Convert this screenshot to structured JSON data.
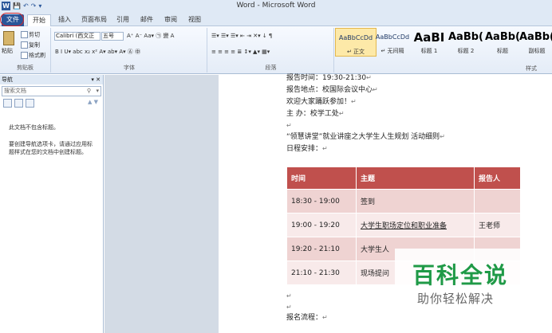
{
  "app": {
    "title": "Word - Microsoft Word",
    "quick_access": [
      "W",
      "💾",
      "↶",
      "↷",
      "▾"
    ]
  },
  "tabs": [
    {
      "label": "文件"
    },
    {
      "label": "开始"
    },
    {
      "label": "插入"
    },
    {
      "label": "页面布局"
    },
    {
      "label": "引用"
    },
    {
      "label": "邮件"
    },
    {
      "label": "审阅"
    },
    {
      "label": "视图"
    }
  ],
  "ribbon": {
    "clipboard": {
      "paste": "粘贴",
      "cut": "剪切",
      "copy": "复制",
      "format_painter": "格式刷",
      "label": "剪贴板"
    },
    "font": {
      "family": "Calibri (西文正",
      "size": "五号",
      "label": "字体",
      "row1": "A⁺ A⁻  Aa▾  ㉠ 變  A",
      "row2": "B  I  U▾  abc  x₂  x²   A▾  ab▾  A▾  Ⓐ  ㊥"
    },
    "paragraph": {
      "label": "段落",
      "row1": "☰▾  ☰▾  ☰▾   ⇤  ⇥   ✕▾  ↓  ¶",
      "row2": "≡  ≡  ≡  ≡  ≣   ↕▾   ▲▾  ▦▾"
    },
    "styles": {
      "label": "样式",
      "items": [
        {
          "sample": "AaBbCcDd",
          "name": "↵ 正文"
        },
        {
          "sample": "AaBbCcDd",
          "name": "↵ 无间隔"
        },
        {
          "sample": "AaBI",
          "name": "标题 1"
        },
        {
          "sample": "AaBb(",
          "name": "标题 2"
        },
        {
          "sample": "AaBb(",
          "name": "标题"
        },
        {
          "sample": "AaBb(",
          "name": "副标题"
        }
      ]
    }
  },
  "nav": {
    "title": "导航",
    "controls": "▾ ✕",
    "search_placeholder": "搜索文档",
    "arrows": "▲ ▼",
    "msg1": "此文档不包含标题。",
    "msg2": "要创建导航选项卡，请通过应用标题样式在您的文档中创建标题。"
  },
  "doc": {
    "line_time": "报告时间：19:30-21:30",
    "line_place": "报告地点：校国际会议中心",
    "line_welcome": "欢迎大家踊跃参加！",
    "line_host": "主  办：校学工处",
    "line_event": "“领慧讲堂”就业讲座之大学生人生规划   活动细则",
    "line_schedule": "日程安排：",
    "line_signup": "报名流程：",
    "para_mark": "↵",
    "table": {
      "headers": [
        "时间",
        "主题",
        "报告人"
      ],
      "rows": [
        [
          "18:30 - 19:00",
          "签到",
          ""
        ],
        [
          "19:00 - 19:20",
          "大学生职场定位和职业准备",
          "王老师"
        ],
        [
          "19:20 - 21:10",
          "大学生人",
          ""
        ],
        [
          "21:10 - 21:30",
          "现场提问",
          ""
        ]
      ]
    }
  },
  "watermark": {
    "title": "百科全说",
    "subtitle": "助你轻松解决"
  }
}
